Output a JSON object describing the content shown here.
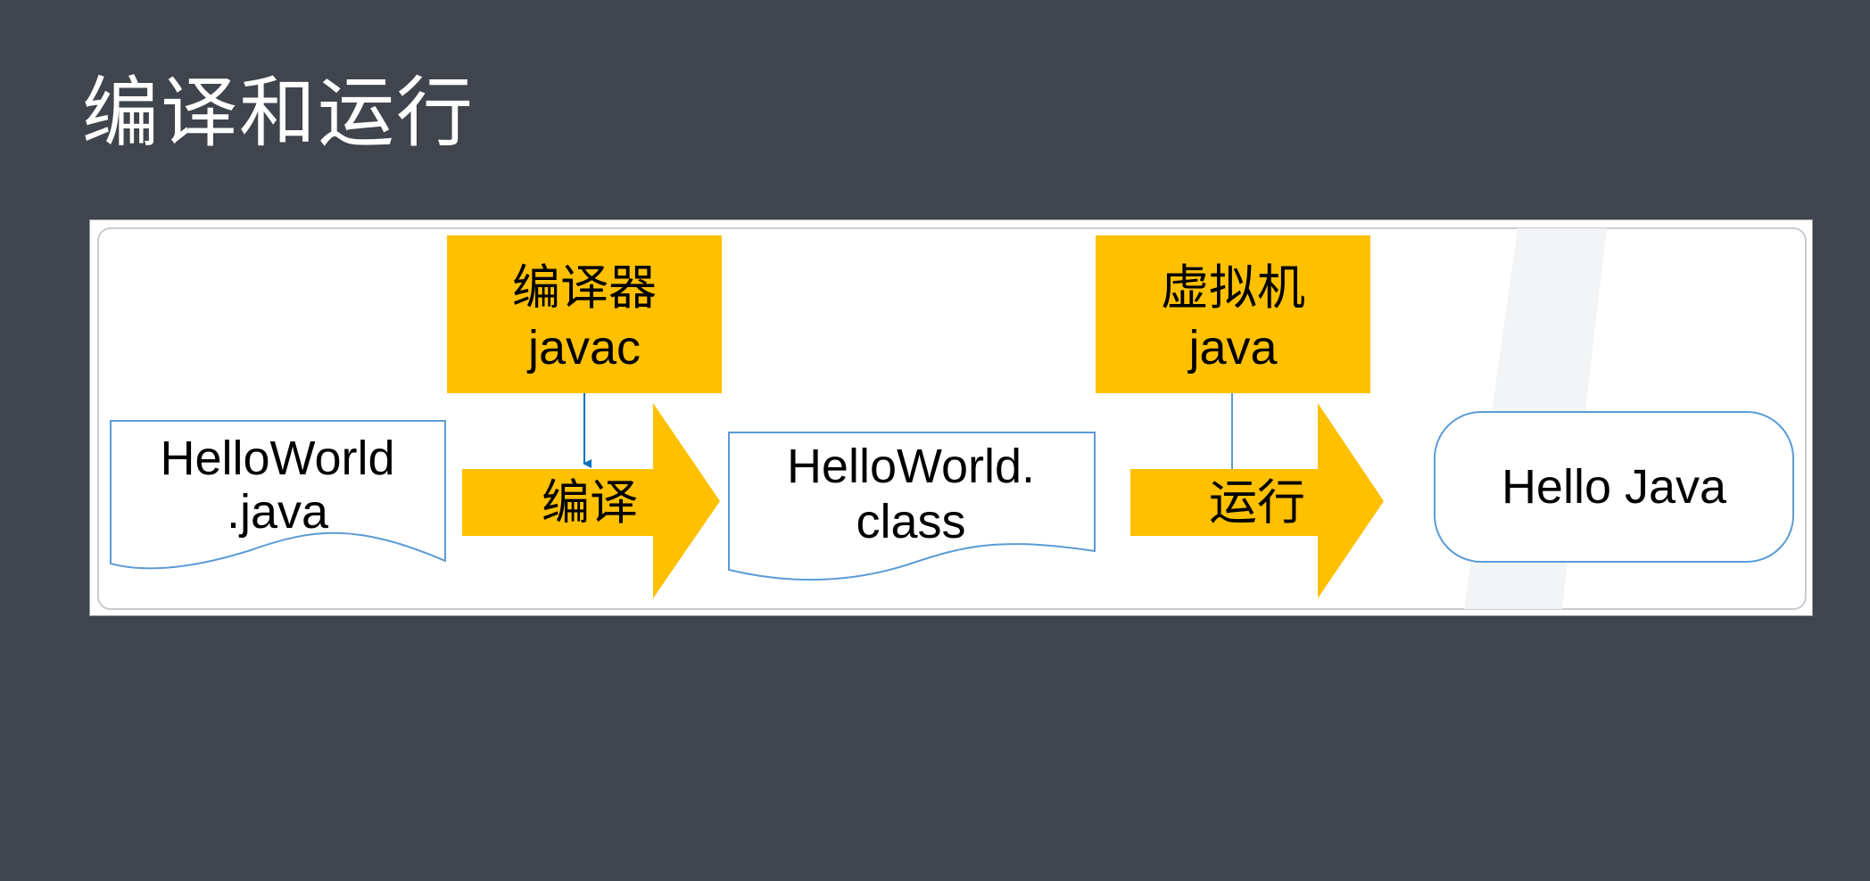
{
  "slide": {
    "title": "编译和运行"
  },
  "diagram": {
    "compiler_box": {
      "line1": "编译器",
      "line2": "javac"
    },
    "vm_box": {
      "line1": "虚拟机",
      "line2": "java"
    },
    "source_file": {
      "line1": "HelloWorld",
      "line2": ".java"
    },
    "class_file": {
      "line1": "HelloWorld.",
      "line2": "class"
    },
    "compile_arrow_label": "编译",
    "run_arrow_label": "运行",
    "output_box_label": "Hello Java"
  },
  "colors": {
    "background": "#40444c",
    "accent": "#ffc000",
    "connector": "#0070c0",
    "shape_outline": "#5b9bd5",
    "text": "#000000"
  }
}
